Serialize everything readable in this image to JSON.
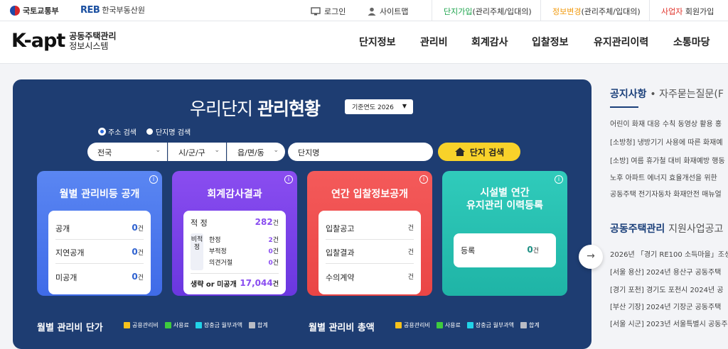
{
  "topbar": {
    "gov_name": "국토교통부",
    "reb_logo": "REB",
    "reb_name": "한국부동산원",
    "login": "로그인",
    "sitemap": "사이트맵",
    "join_complex_a": "단지가입",
    "join_complex_b": "(관리주체/입대의)",
    "info_change_a": "정보변경",
    "info_change_b": "(관리주체/입대의)",
    "biz_join_a": "사업자",
    "biz_join_b": " 회원가입"
  },
  "header": {
    "logo_main": "K-apt",
    "logo_sub1": "공동주택관리",
    "logo_sub2": "정보시스템",
    "nav": [
      "단지정보",
      "관리비",
      "회계감사",
      "입찰정보",
      "유지관리이력",
      "소통마당"
    ]
  },
  "banner": {
    "title_light": "우리단지",
    "title_bold": "관리현황",
    "year_select": "기준연도 2026",
    "radio_address": "주소 검색",
    "radio_name": "단지명 검색",
    "sel_sido": "전국",
    "sel_sigungu": "시/군/구",
    "sel_dong": "읍/면/동",
    "complex_name_label": "단지명",
    "search_button": "단지 검색",
    "cards": {
      "fee": {
        "title": "월별 관리비등 공개",
        "rows": [
          {
            "label": "공개",
            "num": "0",
            "unit": "건"
          },
          {
            "label": "지연공개",
            "num": "0",
            "unit": "건"
          },
          {
            "label": "미공개",
            "num": "0",
            "unit": "건"
          }
        ]
      },
      "audit": {
        "title": "회계감사결과",
        "proper_label": "적 정",
        "proper_num": "282",
        "unit": "건",
        "nonproper_label": "비적정",
        "sub_rows": [
          {
            "label": "한정",
            "num": "2"
          },
          {
            "label": "부적정",
            "num": "0"
          },
          {
            "label": "의견거절",
            "num": "0"
          }
        ],
        "omit_label": "생략 or 미공개",
        "omit_num": "17,044"
      },
      "bid": {
        "title": "연간 입찰정보공개",
        "rows": [
          {
            "label": "입찰공고",
            "unit": "건"
          },
          {
            "label": "입찰결과",
            "unit": "건"
          },
          {
            "label": "수의계약",
            "unit": "건"
          }
        ]
      },
      "maint": {
        "title_1": "시설별 연간",
        "title_2": "유지관리 이력등록",
        "row_label": "등록",
        "row_num": "0",
        "row_unit": "건"
      }
    },
    "chart1_title": "월별 관리비 단가",
    "chart2_title": "월별 관리비 총액",
    "legend": [
      "공용관리비",
      "사용료",
      "장충금 월부과액",
      "합계"
    ],
    "legend_colors": [
      "#f8c21c",
      "#3ecb3e",
      "#21d3e8",
      "#b9bcc4"
    ]
  },
  "side": {
    "notice_title": "공지사항",
    "faq_title": "자주묻는질문(F",
    "notices": [
      "어린이 화재 대응 수칙 동영상 활용 홍",
      "[소방청] 냉방기기 사용에 따른 화재예",
      "[소방] 여름 휴가철 대비 화재예방 행동",
      "노후 아파트 에너지 효율개선을 위한",
      "공동주택 전기자동차 화재안전 매뉴얼"
    ],
    "support_title_a": "공동주택관리",
    "support_title_b": "지원사업공고",
    "supports": [
      "2026년 「경기 RE100 소득마을」조성",
      "[서울 용산] 2024년 용산구 공동주택",
      "[경기 포천] 경기도 포천시 2024년 공",
      "[부산 기장] 2024년 기장군 공동주택",
      "[서울 시군] 2023년 서울특별시 공동주"
    ]
  }
}
